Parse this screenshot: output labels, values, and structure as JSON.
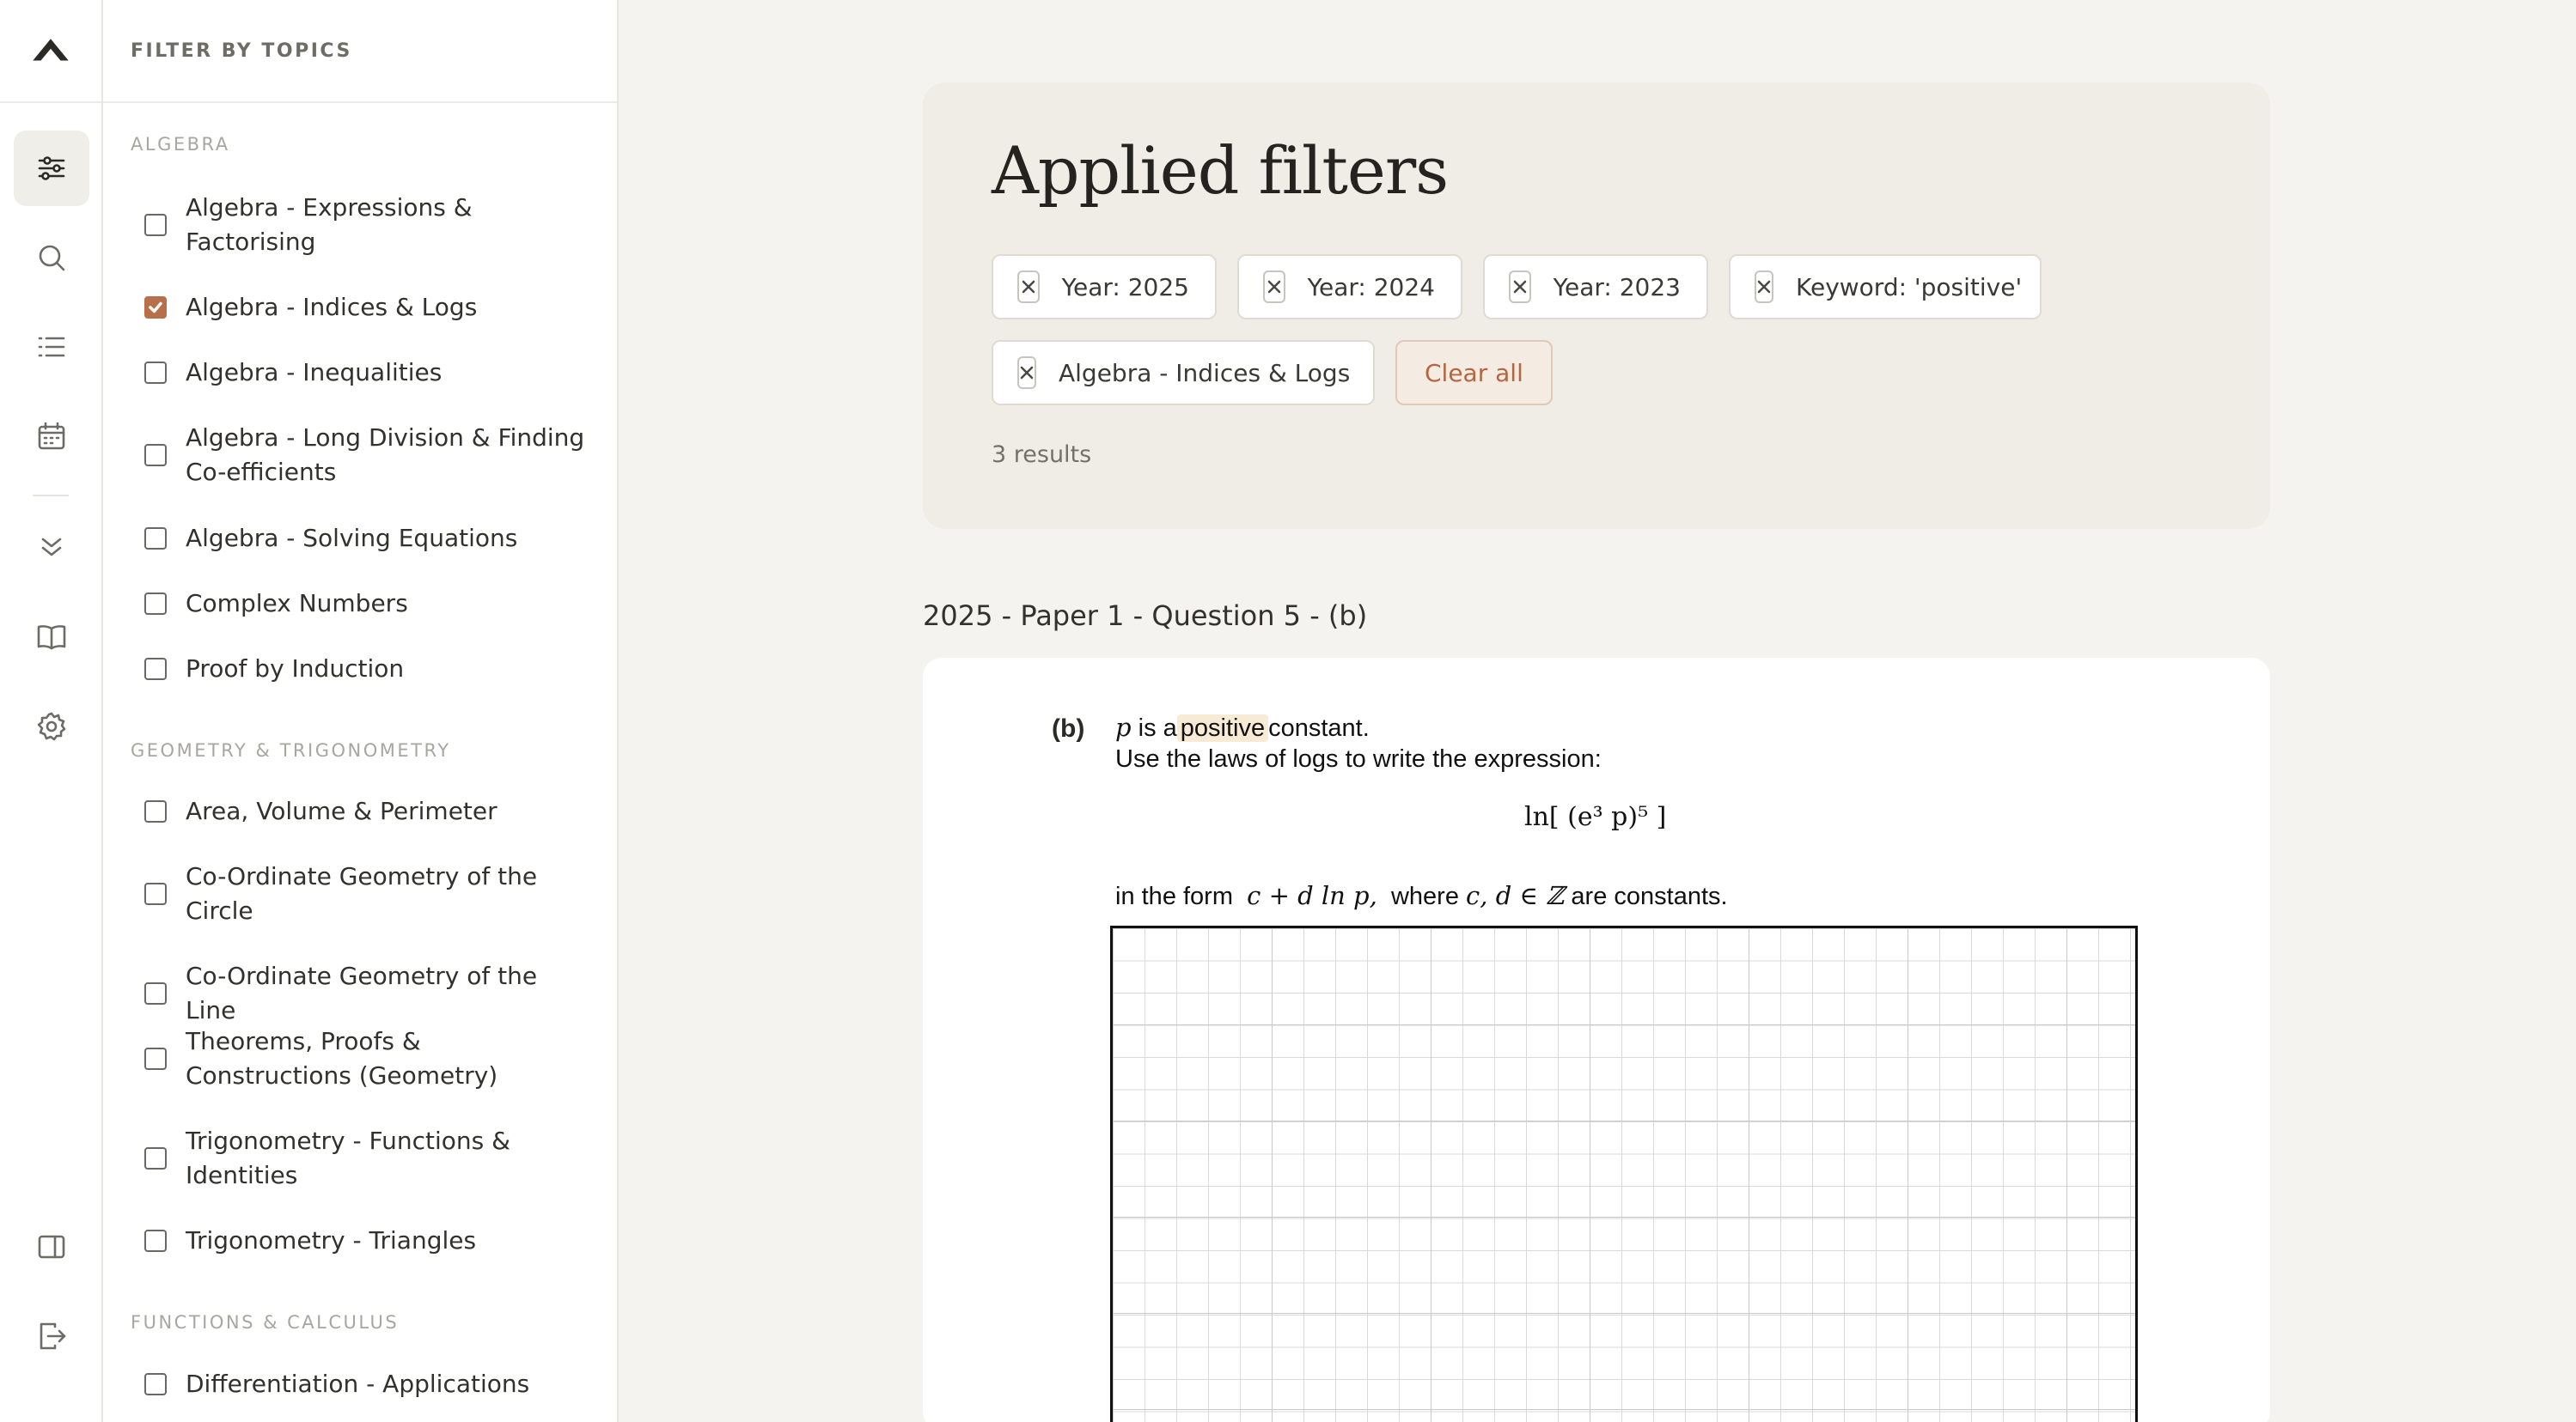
{
  "sidebar": {
    "header": "FILTER BY TOPICS",
    "sections": [
      {
        "title": "ALGEBRA"
      },
      {
        "title": "GEOMETRY & TRIGONOMETRY"
      },
      {
        "title": "FUNCTIONS & CALCULUS"
      }
    ],
    "topics": [
      {
        "label": "Algebra - Expressions & Factorising",
        "checked": false
      },
      {
        "label": "Algebra - Indices & Logs",
        "checked": true
      },
      {
        "label": "Algebra - Inequalities",
        "checked": false
      },
      {
        "label": "Algebra - Long Division & Finding Co-efficients",
        "checked": false
      },
      {
        "label": "Algebra - Solving Equations",
        "checked": false
      },
      {
        "label": "Complex Numbers",
        "checked": false
      },
      {
        "label": "Proof by Induction",
        "checked": false
      },
      {
        "label": "Area, Volume & Perimeter",
        "checked": false
      },
      {
        "label": "Co-Ordinate Geometry of the Circle",
        "checked": false
      },
      {
        "label": "Co-Ordinate Geometry of the Line",
        "checked": false
      },
      {
        "label": "Theorems, Proofs & Constructions (Geometry)",
        "checked": false
      },
      {
        "label": "Trigonometry - Functions & Identities",
        "checked": false
      },
      {
        "label": "Trigonometry - Triangles",
        "checked": false
      },
      {
        "label": "Differentiation - Applications",
        "checked": false
      }
    ]
  },
  "filters": {
    "title": "Applied filters",
    "chips": [
      "Year: 2025",
      "Year: 2024",
      "Year: 2023",
      "Keyword: 'positive'",
      "Algebra - Indices & Logs"
    ],
    "clear_label": "Clear all",
    "results": "3 results"
  },
  "question": {
    "title": "2025 - Paper 1 - Question 5 - (b)",
    "part": "(b)",
    "var_p": "p",
    "line1_mid": "is a",
    "keyword": "positive",
    "line1_end": "constant.",
    "line2": "Use the laws of logs to write the expression:",
    "expression": "ln[ (e³ p)⁵ ]",
    "line3_start": "in the form",
    "form": "c + d ln p,",
    "line3_mid": "where",
    "constants": "c, d ∈ ℤ",
    "line3_end": "are constants."
  }
}
